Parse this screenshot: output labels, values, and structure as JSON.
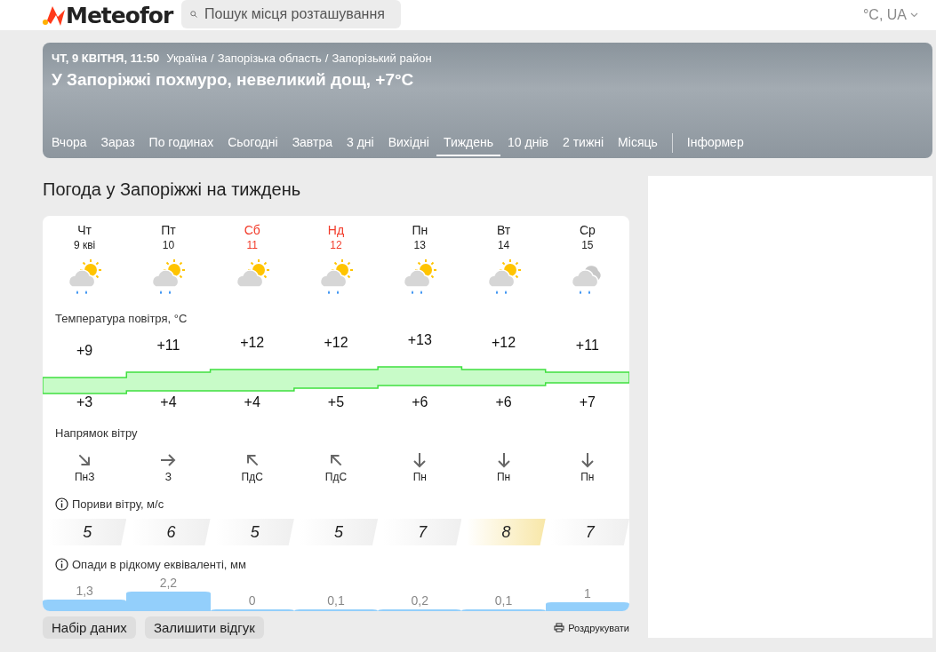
{
  "header": {
    "logo": "Meteofor",
    "search": {
      "placeholder": "Пошук місця розташування"
    },
    "units": "°C, UA"
  },
  "banner": {
    "date": "ЧТ, 9 КВІТНЯ, 11:50",
    "breadcrumbs": [
      "Україна",
      "Запорізька область",
      "Запорізький район"
    ],
    "separator": "/",
    "headline": "У Запоріжжі похмуро, невеликий дощ, +7°C",
    "tabs": [
      {
        "label": "Вчора",
        "selected": false
      },
      {
        "label": "Зараз",
        "selected": false
      },
      {
        "label": "По годинах",
        "selected": false
      },
      {
        "label": "Сьогодні",
        "selected": false
      },
      {
        "label": "Завтра",
        "selected": false
      },
      {
        "label": "3 дні",
        "selected": false
      },
      {
        "label": "Вихідні",
        "selected": false
      },
      {
        "label": "Тиждень",
        "selected": true
      },
      {
        "label": "10 днів",
        "selected": false
      },
      {
        "label": "2 тижні",
        "selected": false
      },
      {
        "label": "Місяць",
        "selected": false
      }
    ],
    "extra_tab": "Інформер"
  },
  "title": "Погода у Запоріжжі на тиждень",
  "days": [
    {
      "weekday": "Чт",
      "date": "9 кві",
      "weekend": false,
      "kind": "sun-cloud-rain",
      "max": "+9",
      "min": "+3",
      "wind": {
        "kind": "down-right",
        "label": "ПнЗ"
      },
      "gust": "5",
      "gust_high": false,
      "precip": "1,3"
    },
    {
      "weekday": "Пт",
      "date": "10",
      "weekend": false,
      "kind": "sun-cloud-rain",
      "max": "+11",
      "min": "+4",
      "wind": {
        "kind": "right",
        "label": "З"
      },
      "gust": "6",
      "gust_high": false,
      "precip": "2,2"
    },
    {
      "weekday": "Сб",
      "date": "11",
      "weekend": true,
      "kind": "sun-cloud",
      "max": "+12",
      "min": "+4",
      "wind": {
        "kind": "up-left",
        "label": "ПдС"
      },
      "gust": "5",
      "gust_high": false,
      "precip": "0"
    },
    {
      "weekday": "Нд",
      "date": "12",
      "weekend": true,
      "kind": "sun-cloud-rain",
      "max": "+12",
      "min": "+5",
      "wind": {
        "kind": "up-left",
        "label": "ПдС"
      },
      "gust": "5",
      "gust_high": false,
      "precip": "0,1"
    },
    {
      "weekday": "Пн",
      "date": "13",
      "weekend": false,
      "kind": "sun-cloud-rain",
      "max": "+13",
      "min": "+6",
      "wind": {
        "kind": "down",
        "label": "Пн"
      },
      "gust": "7",
      "gust_high": false,
      "precip": "0,2"
    },
    {
      "weekday": "Вт",
      "date": "14",
      "weekend": false,
      "kind": "sun-cloud-rain",
      "max": "+12",
      "min": "+6",
      "wind": {
        "kind": "down",
        "label": "Пн"
      },
      "gust": "8",
      "gust_high": true,
      "precip": "0,1"
    },
    {
      "weekday": "Ср",
      "date": "15",
      "weekend": false,
      "kind": "cloud-rain",
      "max": "+11",
      "min": "+7",
      "wind": {
        "kind": "down",
        "label": "Пн"
      },
      "gust": "7",
      "gust_high": false,
      "precip": "1"
    }
  ],
  "sections": {
    "temperature": "Температура повітря, °C",
    "wind": "Напрямок вітру",
    "gusts": "Пориви вітру, м/с",
    "precipitation": "Опади в рідкому еквіваленті, мм"
  },
  "buttons": [
    "Набір даних",
    "Залишити відгук"
  ],
  "print": "Роздрукувати"
}
